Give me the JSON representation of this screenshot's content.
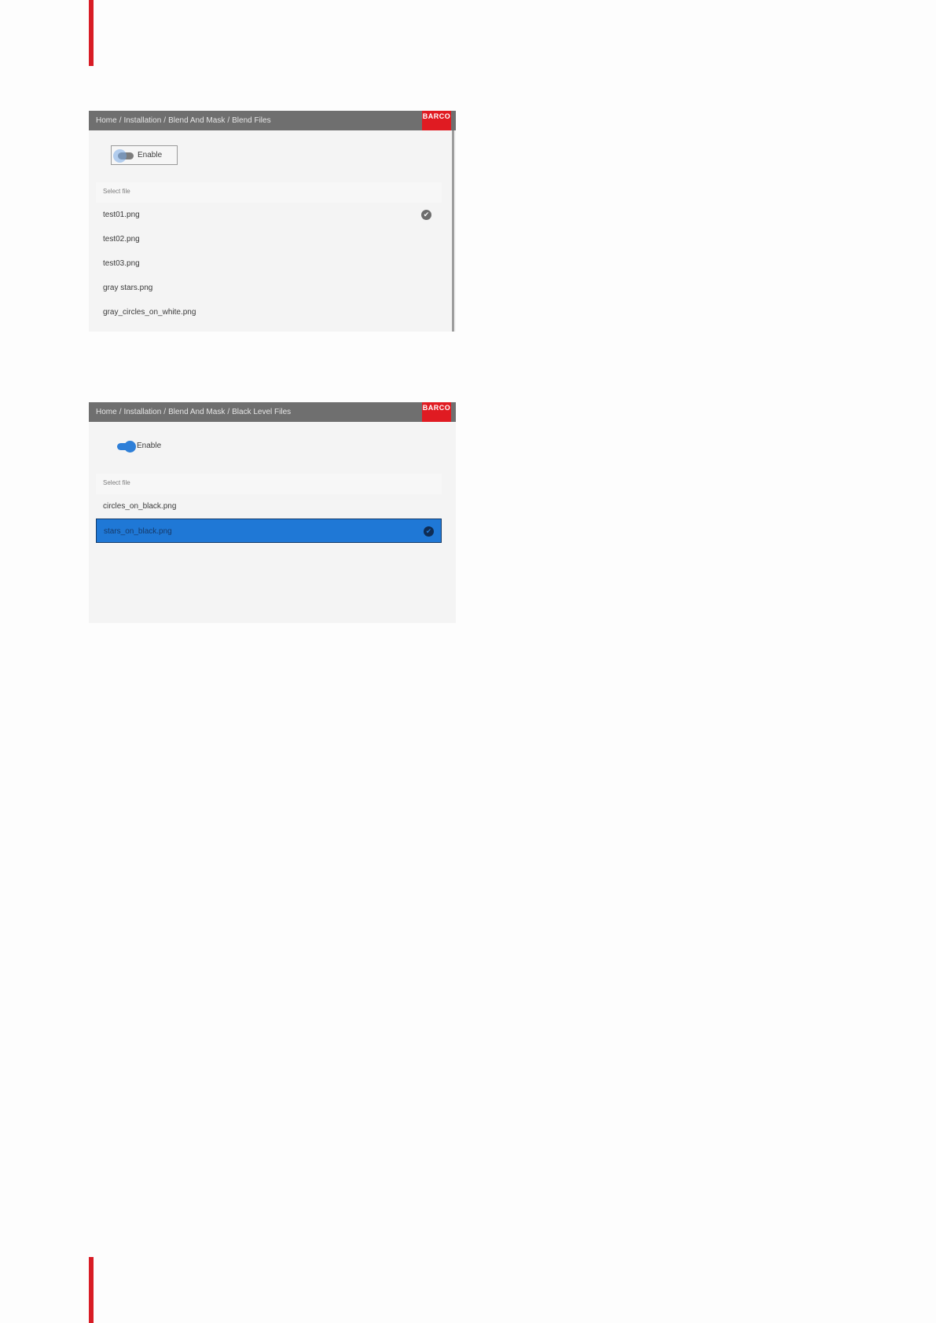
{
  "screens": [
    {
      "breadcrumb": [
        "Home",
        "Installation",
        "Blend And Mask",
        "Blend Files"
      ],
      "logo": "BARCO",
      "enable": {
        "label": "Enable",
        "state": "off"
      },
      "list_header": "Select file",
      "files": [
        "test01.png",
        "test02.png",
        "test03.png",
        "gray stars.png",
        "gray_circles_on_white.png"
      ],
      "check_symbol": "✔"
    },
    {
      "breadcrumb": [
        "Home",
        "Installation",
        "Blend And Mask",
        "Black Level Files"
      ],
      "logo": "BARCO",
      "enable": {
        "label": "Enable",
        "state": "on"
      },
      "list_header": "Select file",
      "files": [
        "circles_on_black.png",
        "stars_on_black.png"
      ],
      "check_symbol": "✔"
    }
  ],
  "colors": {
    "accent": "#1f78d6",
    "brand": "#e01b22",
    "header": "#6f6f6f"
  }
}
